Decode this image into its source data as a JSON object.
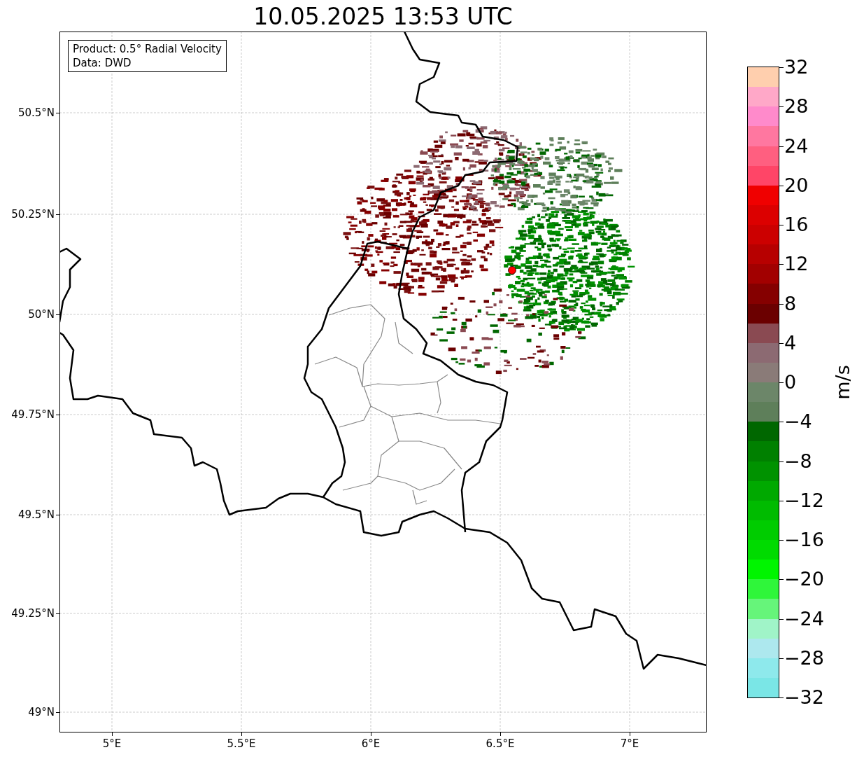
{
  "title": "10.05.2025 13:53 UTC",
  "legend": {
    "lines": [
      "Product: 0.5° Radial Velocity",
      "Data: DWD"
    ]
  },
  "map": {
    "x_ticks": [
      "5°E",
      "5.5°E",
      "6°E",
      "6.5°E",
      "7°E"
    ],
    "y_ticks": [
      "50.5°N",
      "50.25°N",
      "50°N",
      "49.75°N",
      "49.5°N",
      "49.25°N",
      "49°N"
    ]
  },
  "colorbar": {
    "label": "m/s",
    "ticks": [
      "32",
      "28",
      "24",
      "20",
      "16",
      "12",
      "8",
      "4",
      "0",
      "−4",
      "−8",
      "−12",
      "−16",
      "−20",
      "−24",
      "−28",
      "−32"
    ],
    "segments": [
      {
        "color": "#ffcfae"
      },
      {
        "color": "#ffa8c8"
      },
      {
        "color": "#ff8acb"
      },
      {
        "color": "#ff77a0"
      },
      {
        "color": "#ff5f80"
      },
      {
        "color": "#ff4567"
      },
      {
        "color": "#f00000"
      },
      {
        "color": "#dc0000"
      },
      {
        "color": "#cc0000"
      },
      {
        "color": "#b70000"
      },
      {
        "color": "#a20000"
      },
      {
        "color": "#850000"
      },
      {
        "color": "#6b0000"
      },
      {
        "color": "#8a4a52"
      },
      {
        "color": "#8c6a72"
      },
      {
        "color": "#8a7b78"
      },
      {
        "color": "#6c8669"
      },
      {
        "color": "#5e7f5a"
      },
      {
        "color": "#006700"
      },
      {
        "color": "#008000"
      },
      {
        "color": "#009200"
      },
      {
        "color": "#00a900"
      },
      {
        "color": "#00bb00"
      },
      {
        "color": "#00cc00"
      },
      {
        "color": "#00db00"
      },
      {
        "color": "#00f500"
      },
      {
        "color": "#2ff63a"
      },
      {
        "color": "#66f57a"
      },
      {
        "color": "#a0f4c8"
      },
      {
        "color": "#ade8ee"
      },
      {
        "color": "#8ee9ec"
      },
      {
        "color": "#7ae6e6"
      }
    ]
  }
}
